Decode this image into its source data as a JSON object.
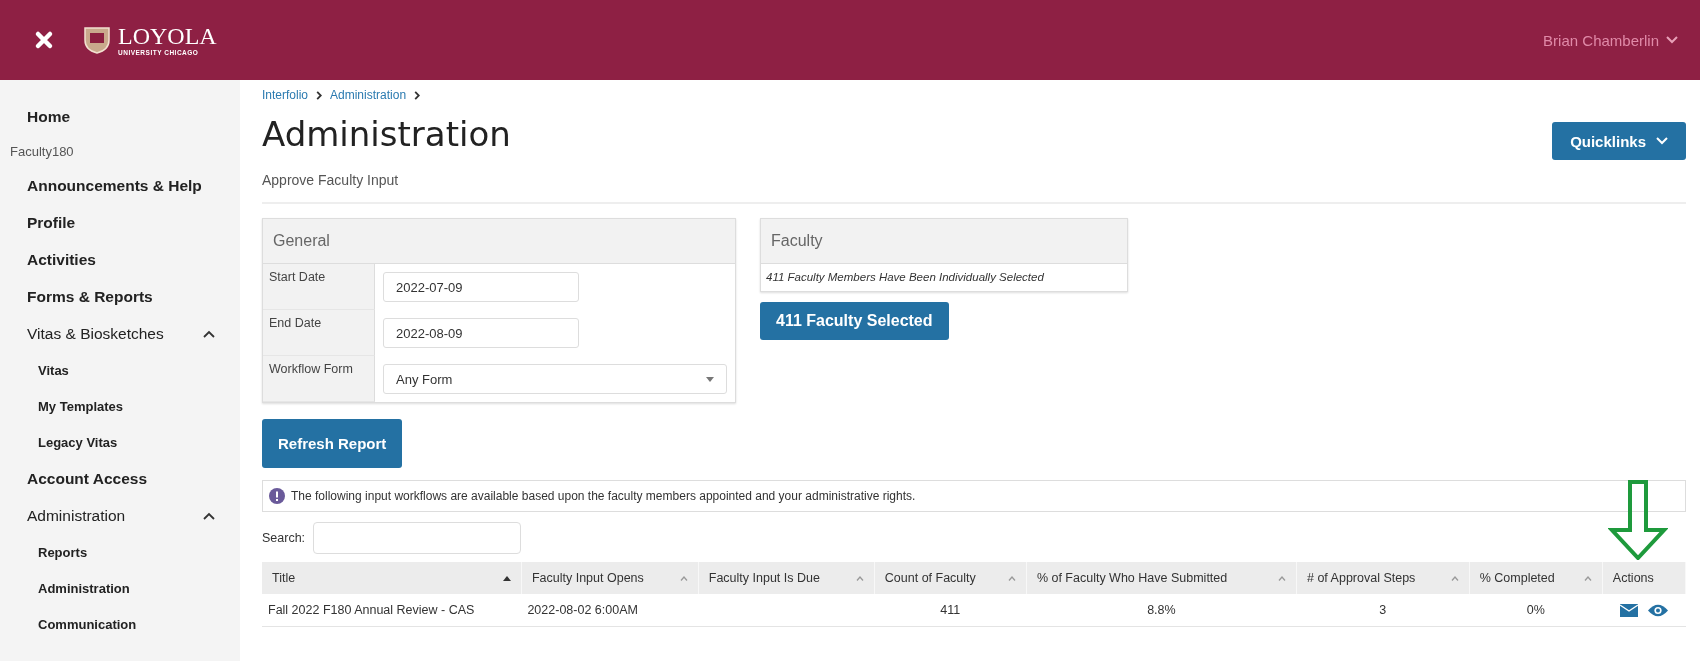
{
  "header": {
    "logo": {
      "name": "LOYOLA",
      "subtitle": "UNIVERSITY CHICAGO"
    },
    "user": "Brian Chamberlin"
  },
  "sidebar": {
    "items": [
      {
        "kind": "link",
        "label": "Home"
      },
      {
        "kind": "label",
        "label": "Faculty180"
      },
      {
        "kind": "link",
        "label": "Announcements & Help"
      },
      {
        "kind": "link",
        "label": "Profile"
      },
      {
        "kind": "link",
        "label": "Activities"
      },
      {
        "kind": "link",
        "label": "Forms & Reports"
      },
      {
        "kind": "group",
        "label": "Vitas & Biosketches",
        "expanded": true,
        "children": [
          {
            "label": "Vitas"
          },
          {
            "label": "My Templates"
          },
          {
            "label": "Legacy Vitas"
          }
        ]
      },
      {
        "kind": "link",
        "label": "Account Access"
      },
      {
        "kind": "group",
        "label": "Administration",
        "expanded": true,
        "children": [
          {
            "label": "Reports"
          },
          {
            "label": "Administration"
          },
          {
            "label": "Communication"
          }
        ]
      }
    ]
  },
  "breadcrumbs": [
    "Interfolio",
    "Administration"
  ],
  "page": {
    "title": "Administration",
    "subtitle": "Approve Faculty Input",
    "quicklinks": "Quicklinks"
  },
  "general": {
    "title": "General",
    "fields": [
      {
        "kind": "input",
        "label": "Start Date",
        "value": "2022-07-09"
      },
      {
        "kind": "input",
        "label": "End Date",
        "value": "2022-08-09"
      },
      {
        "kind": "select",
        "label": "Workflow Form",
        "value": "Any Form"
      }
    ]
  },
  "faculty": {
    "title": "Faculty",
    "note": "411 Faculty Members Have Been Individually Selected",
    "button": "411 Faculty Selected"
  },
  "refresh_button": "Refresh Report",
  "info": "The following input workflows are available based upon the faculty members appointed and your administrative rights.",
  "search": {
    "label": "Search:"
  },
  "table": {
    "columns": [
      {
        "label": "Title",
        "sortable": true,
        "sorted": true
      },
      {
        "label": "Faculty Input Opens",
        "sortable": true,
        "sorted": false
      },
      {
        "label": "Faculty Input Is Due",
        "sortable": true,
        "sorted": false
      },
      {
        "label": "Count of Faculty",
        "sortable": true,
        "sorted": false
      },
      {
        "label": "% of Faculty Who Have Submitted",
        "sortable": true,
        "sorted": false
      },
      {
        "label": "# of Approval Steps",
        "sortable": true,
        "sorted": false
      },
      {
        "label": "% Completed",
        "sortable": true,
        "sorted": false
      },
      {
        "label": "Actions",
        "sortable": false
      }
    ],
    "rows": [
      {
        "cells": [
          "Fall 2022 F180 Annual Review - CAS",
          "2022-08-02 6:00AM",
          "",
          "411",
          "8.8%",
          "3",
          "0%"
        ],
        "actions": [
          {
            "kind": "email"
          },
          {
            "kind": "view"
          }
        ]
      }
    ]
  }
}
